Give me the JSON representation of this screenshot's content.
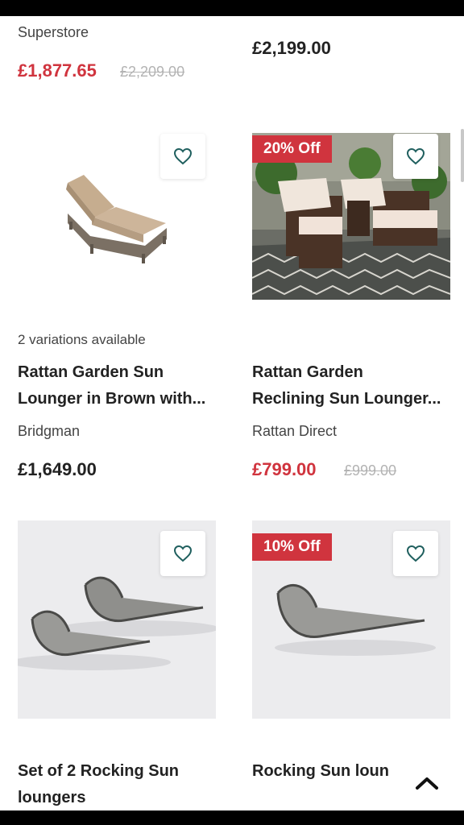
{
  "products_top": [
    {
      "seller": "Superstore",
      "price": "£1,877.65",
      "was_price": "£2,209.00"
    },
    {
      "price": "£2,199.00"
    }
  ],
  "products": [
    {
      "variations": "2 variations available",
      "title_line1": "Rattan Garden Sun",
      "title_line2": "Lounger in Brown with...",
      "seller": "Bridgman",
      "price": "£1,649.00"
    },
    {
      "badge": "20% Off",
      "title_line1": "Rattan Garden",
      "title_line2": "Reclining Sun Lounger...",
      "seller": "Rattan Direct",
      "price": "£799.00",
      "was_price": "£999.00"
    },
    {
      "title_line1": "Set of 2 Rocking Sun",
      "title_line2": "loungers"
    },
    {
      "badge": "10% Off",
      "title_line1": "Rocking Sun loun"
    }
  ],
  "icons": {
    "wishlist": "heart-outline-icon",
    "scroll_top": "chevron-up-icon"
  },
  "colors": {
    "sale_price": "#d0343e",
    "badge_bg": "#d0343e",
    "heart_stroke": "#1f5f5e"
  }
}
